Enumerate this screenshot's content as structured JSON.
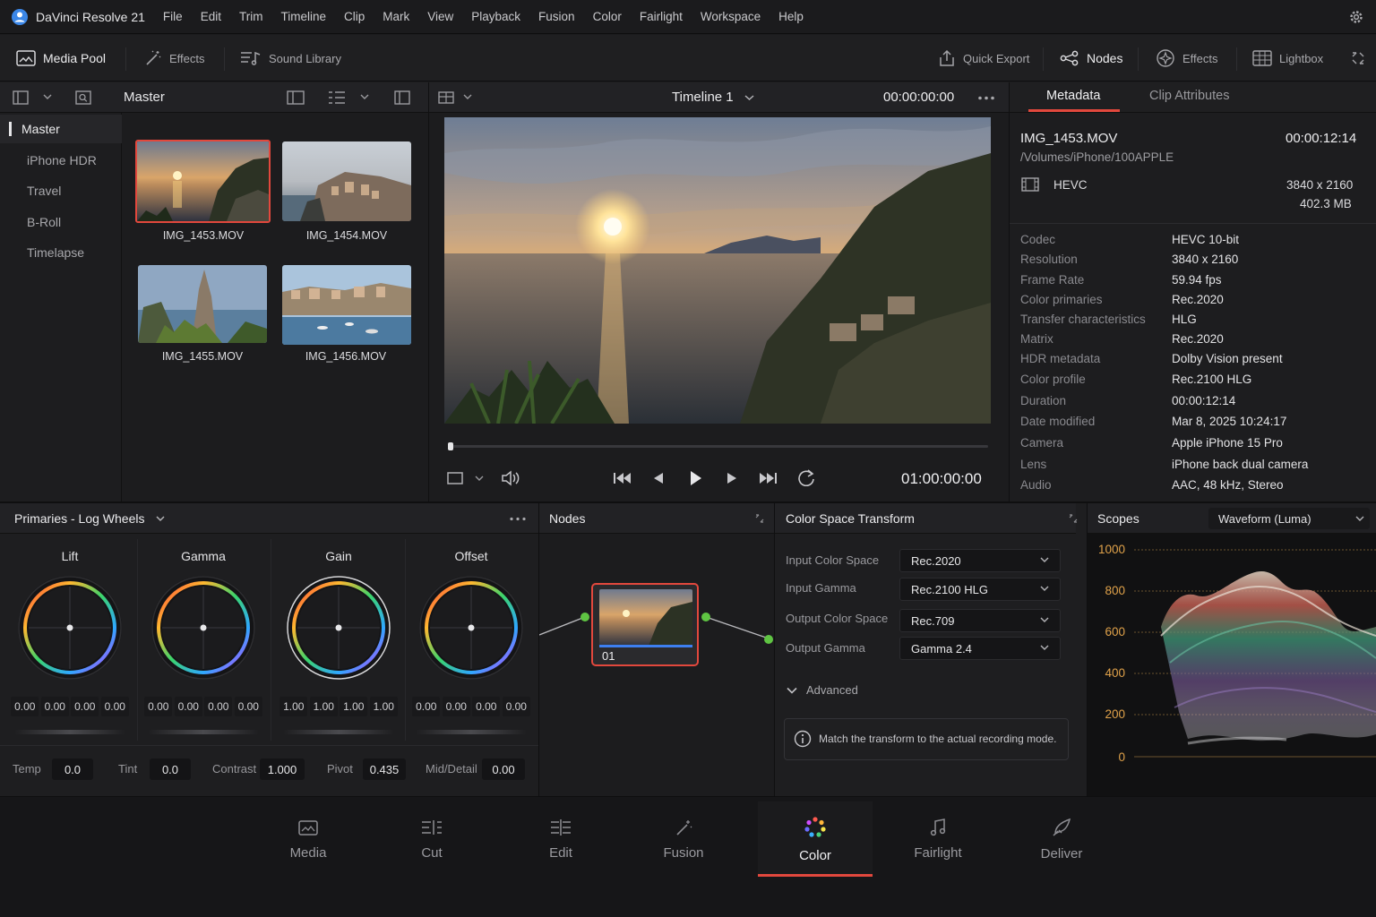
{
  "app": {
    "title": "DaVinci Resolve 21"
  },
  "menu": [
    "File",
    "Edit",
    "Trim",
    "Timeline",
    "Clip",
    "Mark",
    "View",
    "Playback",
    "Fusion",
    "Color",
    "Fairlight",
    "Workspace",
    "Help"
  ],
  "toolbar": {
    "media_pool": "Media Pool",
    "effects_left": "Effects",
    "sound_library": "Sound Library",
    "quick_export": "Quick Export",
    "nodes": "Nodes",
    "effects_right": "Effects",
    "lightbox": "Lightbox"
  },
  "media_pool": {
    "bin_title": "Master",
    "bins": [
      "Master",
      "iPhone HDR",
      "Travel",
      "B-Roll",
      "Timelapse"
    ],
    "clips": [
      "IMG_1453.MOV",
      "IMG_1454.MOV",
      "IMG_1455.MOV",
      "IMG_1456.MOV"
    ]
  },
  "viewer": {
    "timeline_name": "Timeline 1",
    "timecode_top": "00:00:00:00",
    "timecode_bottom": "01:00:00:00",
    "playhead_progress": 0.0
  },
  "inspector": {
    "tabs": [
      "Metadata",
      "Clip Attributes"
    ],
    "active_tab": "Metadata",
    "clip_name": "IMG_1453.MOV",
    "clip_duration": "00:00:12:14",
    "clip_path": "/Volumes/iPhone/100APPLE",
    "codec_short": "HEVC",
    "resolution_short": "3840 x 2160",
    "size": "402.3 MB",
    "rows": [
      {
        "key": "Codec",
        "value": "HEVC 10-bit"
      },
      {
        "key": "Resolution",
        "value": "3840 x 2160"
      },
      {
        "key": "Frame Rate",
        "value": "59.94 fps"
      },
      {
        "key": "Color primaries",
        "value": "Rec.2020"
      },
      {
        "key": "Transfer characteristics",
        "value": "HLG"
      },
      {
        "key": "Matrix",
        "value": "Rec.2020"
      },
      {
        "key": "HDR metadata",
        "value": "Dolby Vision present"
      },
      {
        "key": "Color profile",
        "value": "Rec.2100 HLG"
      },
      {
        "key": "Duration",
        "value": "00:00:12:14"
      },
      {
        "key": "Date modified",
        "value": "Mar 8, 2025 10:24:17"
      },
      {
        "key": "Camera",
        "value": "Apple iPhone 15 Pro"
      },
      {
        "key": "Lens",
        "value": "iPhone back dual camera"
      },
      {
        "key": "Audio",
        "value": "AAC, 48 kHz, Stereo"
      }
    ]
  },
  "primaries": {
    "title": "Primaries - Log Wheels",
    "wheels": [
      {
        "label": "Lift",
        "values": [
          "0.00",
          "0.00",
          "0.00",
          "0.00"
        ]
      },
      {
        "label": "Gamma",
        "values": [
          "0.00",
          "0.00",
          "0.00",
          "0.00"
        ]
      },
      {
        "label": "Gain",
        "values": [
          "1.00",
          "1.00",
          "1.00",
          "1.00"
        ]
      },
      {
        "label": "Offset",
        "values": [
          "0.00",
          "0.00",
          "0.00",
          "0.00"
        ]
      }
    ],
    "params": [
      {
        "label": "Temp",
        "value": "0.0"
      },
      {
        "label": "Tint",
        "value": "0.0"
      },
      {
        "label": "Contrast",
        "value": "1.000"
      },
      {
        "label": "Pivot",
        "value": "0.435"
      },
      {
        "label": "Mid/Detail",
        "value": "0.00"
      }
    ]
  },
  "nodes": {
    "title": "Nodes",
    "node_label": "01"
  },
  "cst": {
    "title": "Color Space Transform",
    "input_color_space_label": "Input Color Space",
    "input_color_space": "Rec.2020",
    "input_gamma_label": "Input Gamma",
    "input_gamma": "Rec.2100 HLG",
    "output_color_space_label": "Output Color Space",
    "output_color_space": "Rec.709",
    "output_gamma_label": "Output Gamma",
    "output_gamma": "Gamma 2.4",
    "advanced": "Advanced",
    "info": "Match the transform to the actual recording mode."
  },
  "scopes": {
    "title": "Scopes",
    "mode": "Waveform (Luma)",
    "ticks": [
      "1000",
      "800",
      "600",
      "400",
      "200",
      "0"
    ]
  },
  "pages": [
    {
      "label": "Media",
      "icon": "media-page-icon"
    },
    {
      "label": "Cut",
      "icon": "cut-page-icon"
    },
    {
      "label": "Edit",
      "icon": "edit-page-icon"
    },
    {
      "label": "Fusion",
      "icon": "fusion-page-icon"
    },
    {
      "label": "Color",
      "icon": "color-page-icon"
    },
    {
      "label": "Fairlight",
      "icon": "fairlight-page-icon"
    },
    {
      "label": "Deliver",
      "icon": "deliver-page-icon"
    }
  ],
  "active_page": "Color",
  "colors": {
    "accent_red": "#e2483d",
    "node_green": "#5fc443",
    "playhead_blue": "#3d7ff0"
  }
}
